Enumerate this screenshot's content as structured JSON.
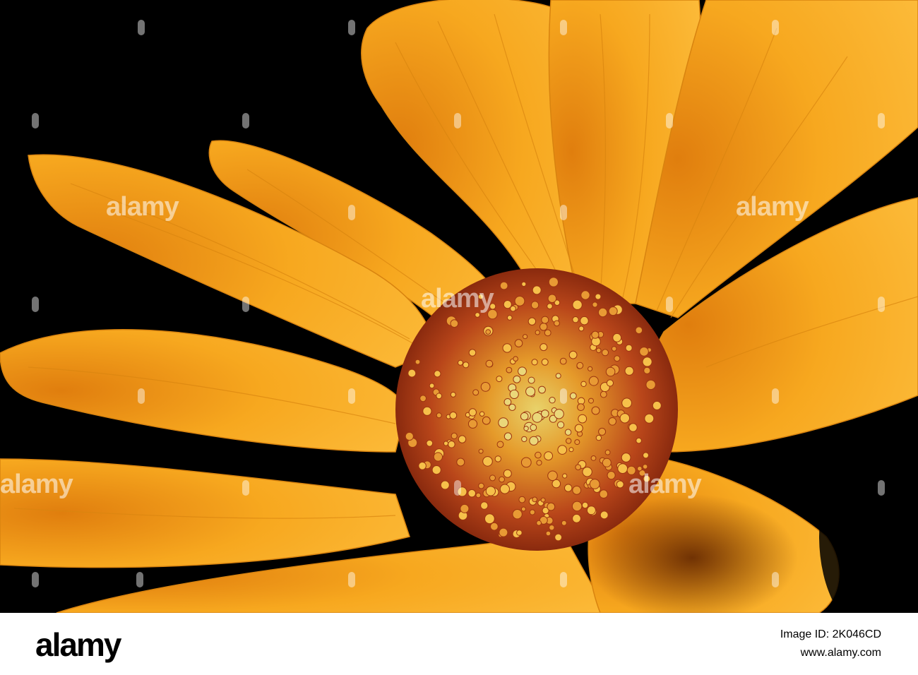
{
  "photo": {
    "subject": "flower-closeup",
    "colors": {
      "background": "#000000",
      "petal": "#F7A81F",
      "petal_dark": "#E08A10",
      "center": "#B84A12",
      "stamen": "#F5C24A",
      "footer_bg": "#FFFFFF",
      "footer_text": "#000000"
    }
  },
  "watermark": {
    "text": "alamy"
  },
  "footer": {
    "logo": "alamy",
    "image_id": "Image ID: 2K046CD",
    "site": "www.alamy.com"
  }
}
